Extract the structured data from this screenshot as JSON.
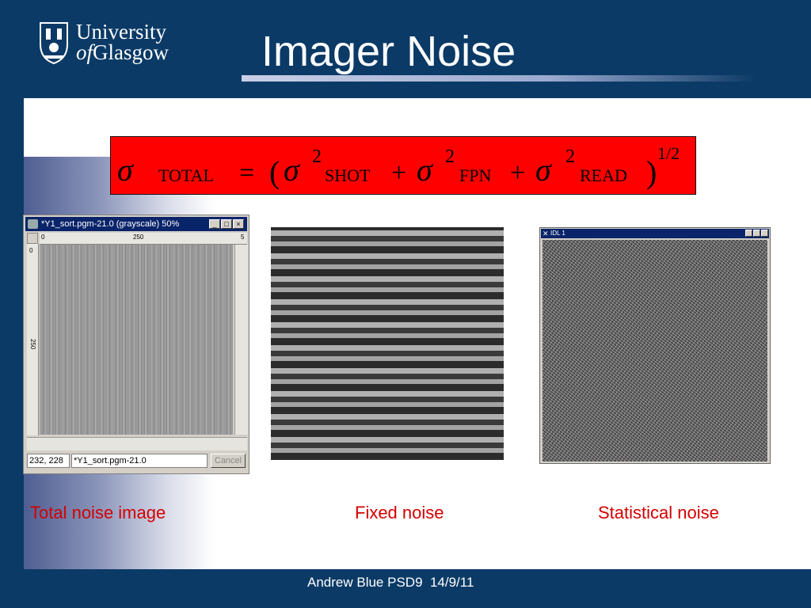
{
  "header": {
    "logo": {
      "line1": "University",
      "line2_prefix": "of",
      "line2": "Glasgow"
    },
    "title": "Imager Noise"
  },
  "formula": {
    "sigma": "σ",
    "total": "TOTAL",
    "equals": "=",
    "open": "(",
    "sq": "2",
    "shot": "SHOT",
    "plus": "+",
    "fpn": "FPN",
    "read": "READ",
    "close": ")",
    "exponent": "1/2"
  },
  "window_total": {
    "title": "*Y1_sort.pgm-21.0 (grayscale) 50%",
    "minimize": "_",
    "maximize": "□",
    "close": "×",
    "ruler_h": [
      "0",
      "250",
      "5"
    ],
    "ruler_v": [
      "0",
      "250"
    ],
    "coords": "232, 228",
    "image_name": "*Y1_sort.pgm-21.0",
    "cancel": "Cancel"
  },
  "window_idl": {
    "title": "IDL 1"
  },
  "captions": {
    "total": "Total noise image",
    "fixed": "Fixed noise",
    "statistical": "Statistical noise"
  },
  "footer": "Andrew Blue PSD9  14/9/11",
  "colors": {
    "background": "#0b3a66",
    "formula_box": "#ff0000",
    "caption": "#d40000"
  }
}
